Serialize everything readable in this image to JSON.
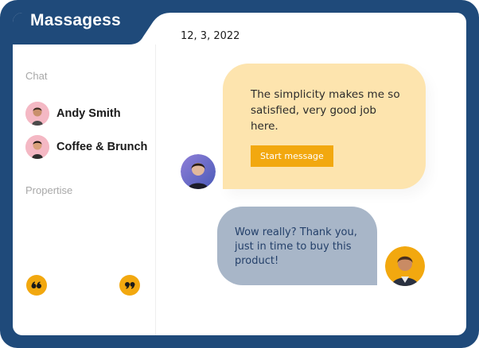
{
  "app": {
    "title": "Massagess"
  },
  "sidebar": {
    "chat_label": "Chat",
    "contacts": [
      {
        "name": "Andy Smith",
        "avatar_icon": "man-avatar-icon"
      },
      {
        "name": "Coffee & Brunch",
        "avatar_icon": "man-avatar-icon"
      }
    ],
    "propertise_label": "Propertise",
    "quote_icons": [
      "open-quote-icon",
      "close-quote-icon"
    ]
  },
  "conversation": {
    "date": "12, 3, 2022",
    "incoming": {
      "text": "The simplicity makes me so satisfied, very good job here.",
      "button_label": "Start message",
      "avatar_icon": "woman-avatar-icon"
    },
    "outgoing": {
      "text": "Wow really? Thank you, just in time to buy this product!",
      "avatar_icon": "man-avatar-icon"
    }
  },
  "colors": {
    "frame": "#1f4a7a",
    "accent": "#f2a80f",
    "incoming_bubble": "#fde4ae",
    "outgoing_bubble": "#a8b6c8",
    "outgoing_text": "#24406a",
    "avatar_pink": "#f4b8c4"
  }
}
